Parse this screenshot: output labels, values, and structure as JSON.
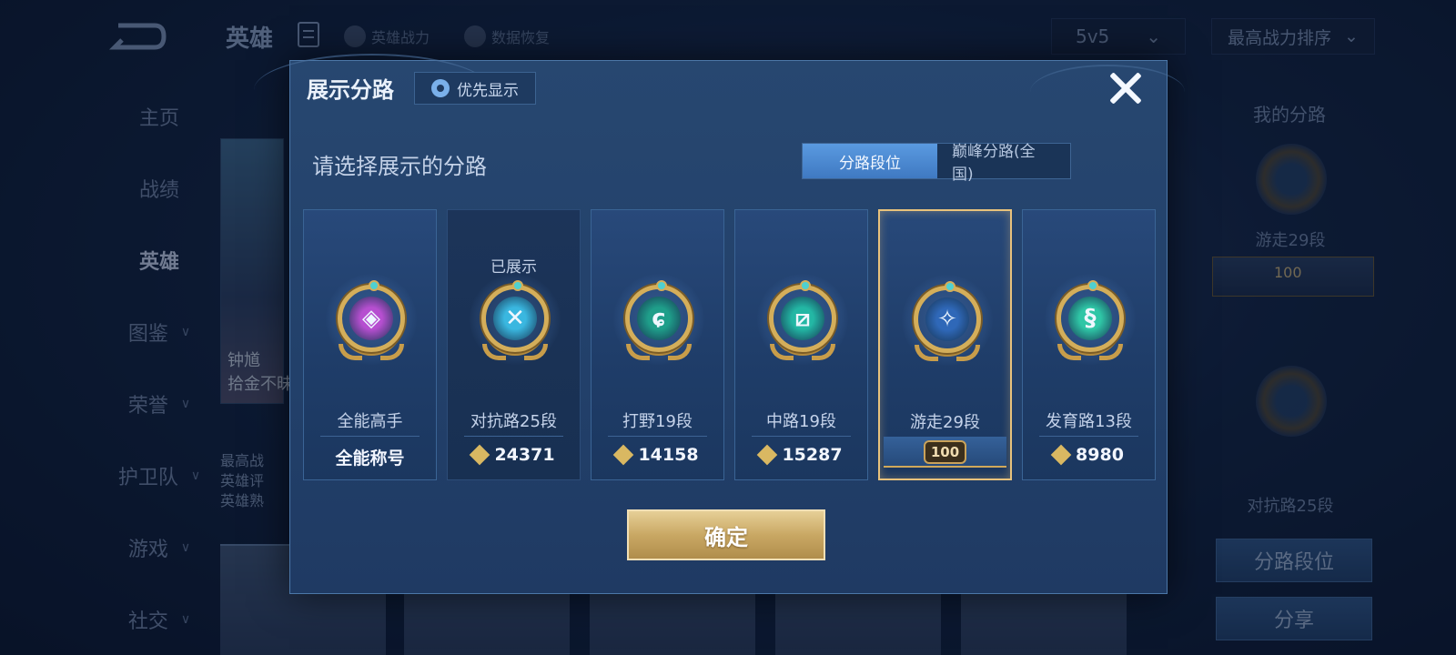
{
  "background": {
    "top_title": "英雄",
    "link_power": "英雄战力",
    "link_restore": "数据恢复",
    "mode_select": "5v5",
    "sort_select": "最高战力排序",
    "side_nav": [
      "主页",
      "战绩",
      "英雄",
      "图鉴",
      "荣誉",
      "护卫队",
      "游戏",
      "社交"
    ],
    "side_nav_active": "英雄",
    "hero_card_name": "钟馗",
    "hero_card_sub": "拾金不昧",
    "hero_info": [
      "最高战",
      "英雄评",
      "英雄熟"
    ],
    "right_panel": {
      "title": "我的分路",
      "lane1": "游走29段",
      "rank_value": "100",
      "lane2": "对抗路25段",
      "btn_lane_rank": "分路段位",
      "btn_share": "分享"
    }
  },
  "modal": {
    "title": "展示分路",
    "priority_btn": "优先显示",
    "prompt": "请选择展示的分路",
    "toggle": {
      "active": "分路段位",
      "inactive": "巅峰分路(全国)"
    },
    "cards": [
      {
        "name": "全能高手",
        "score": "全能称号",
        "glyph": "◈",
        "color": "#b64fd0",
        "shown": false,
        "selected": false
      },
      {
        "name": "对抗路25段",
        "score": "24371",
        "glyph": "✕",
        "color": "#3ab7e0",
        "shown": true,
        "shown_label": "已展示",
        "selected": false
      },
      {
        "name": "打野19段",
        "score": "14158",
        "glyph": "ɕ",
        "color": "#1f9e8a",
        "shown": false,
        "selected": false
      },
      {
        "name": "中路19段",
        "score": "15287",
        "glyph": "⧄",
        "color": "#23b7a4",
        "shown": false,
        "selected": false
      },
      {
        "name": "游走29段",
        "score": "",
        "glyph": "✧",
        "color": "#2f68b8",
        "shown": false,
        "selected": true,
        "rank_value": "100"
      },
      {
        "name": "发育路13段",
        "score": "8980",
        "glyph": "§",
        "color": "#2fc6a6",
        "shown": false,
        "selected": false
      }
    ],
    "confirm": "确定"
  }
}
